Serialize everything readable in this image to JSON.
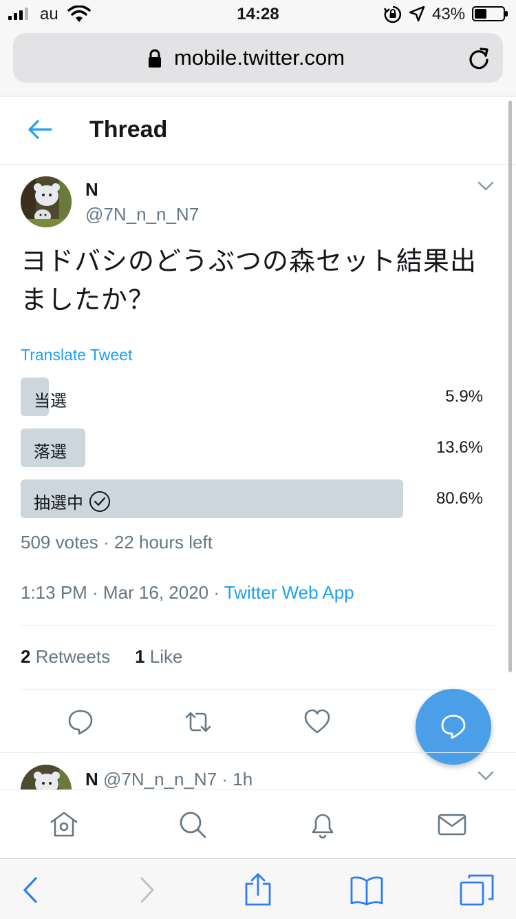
{
  "status_bar": {
    "carrier": "au",
    "time": "14:28",
    "battery_percent": "43%",
    "battery_level": 0.43
  },
  "browser": {
    "url": "mobile.twitter.com"
  },
  "header": {
    "title": "Thread"
  },
  "tweet": {
    "author_name": "N",
    "author_handle": "@7N_n_n_N7",
    "text_line1": "ヨドバシのどうぶつの森セット結果出",
    "text_line2": "ましたか？",
    "translate_label": "Translate Tweet",
    "poll": {
      "options": [
        {
          "label": "当選",
          "percent_text": "5.9%",
          "percent": 5.9,
          "selected": false
        },
        {
          "label": "落選",
          "percent_text": "13.6%",
          "percent": 13.6,
          "selected": false
        },
        {
          "label": "抽選中",
          "percent_text": "80.6%",
          "percent": 80.6,
          "selected": true
        }
      ],
      "summary": "509 votes · 22 hours left"
    },
    "timestamp": "1:13 PM · Mar 16, 2020 · ",
    "source": "Twitter Web App",
    "retweet_count": "2",
    "retweet_label": " Retweets",
    "like_count": "1",
    "like_label": " Like"
  },
  "reply_preview": {
    "author_name": "N",
    "handle_time": " @7N_n_n_N7 · 1h"
  },
  "colors": {
    "accent": "#1da1f2",
    "poll_bar": "#ccd6dd",
    "secondary_text": "#657786",
    "fab": "#4a9fe8"
  },
  "icons": {
    "nav": [
      "home-icon",
      "search-icon",
      "bell-icon",
      "envelope-icon"
    ],
    "actions": [
      "reply-icon",
      "retweet-icon",
      "heart-icon"
    ],
    "safari": [
      "back-icon",
      "forward-icon",
      "share-icon",
      "bookmarks-icon",
      "tabs-icon"
    ]
  }
}
